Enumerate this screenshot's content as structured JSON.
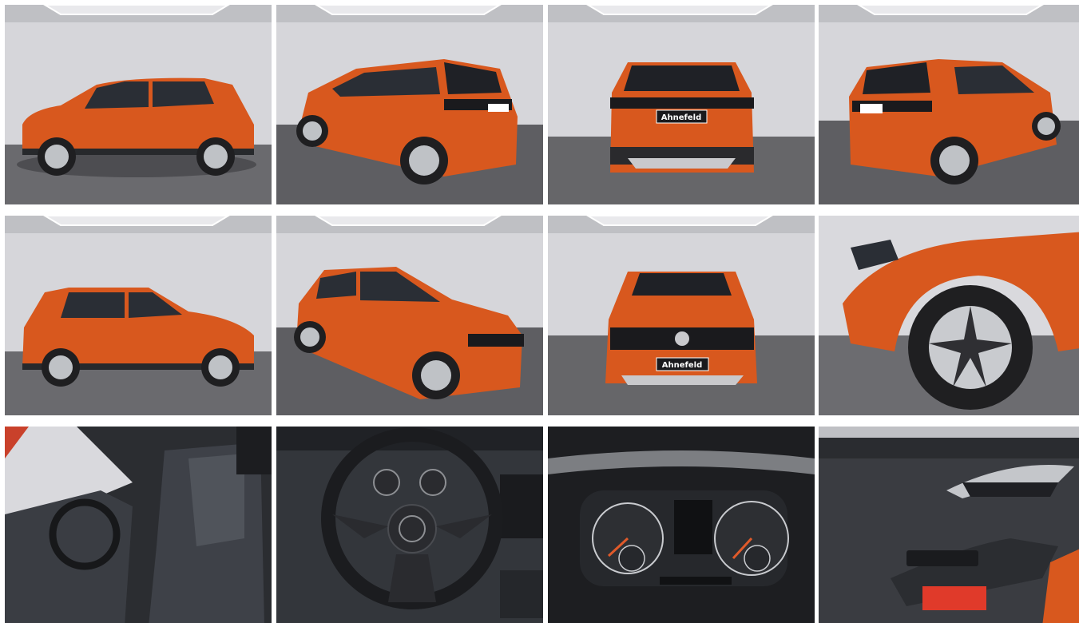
{
  "gallery": {
    "colors": {
      "car_orange": "#d8581e",
      "car_orange_dark": "#9c3a10",
      "studio_wall": "#d9d9dd",
      "studio_floor": "#6f6f73",
      "interior_dark": "#2b2d31"
    },
    "dealer_plate": "Ahnefeld",
    "photos": [
      {
        "view": "side-left"
      },
      {
        "view": "rear-three-quarter-left"
      },
      {
        "view": "rear"
      },
      {
        "view": "rear-three-quarter-right"
      },
      {
        "view": "side-right"
      },
      {
        "view": "front-three-quarter-right"
      },
      {
        "view": "front"
      },
      {
        "view": "wheel-closeup"
      },
      {
        "view": "interior-driver-seat"
      },
      {
        "view": "steering-wheel"
      },
      {
        "view": "instrument-cluster"
      },
      {
        "view": "door-panel"
      }
    ]
  }
}
